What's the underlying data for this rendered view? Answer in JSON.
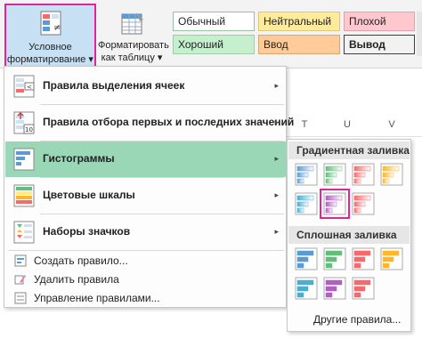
{
  "ribbon": {
    "conditional_formatting": {
      "line1": "Условное",
      "line2": "форматирование ▾"
    },
    "format_as_table": {
      "line1": "Форматировать",
      "line2": "как таблицу ▾"
    },
    "cell_styles": [
      {
        "label": "Обычный",
        "bg": "#ffffff",
        "border": "#9bbfa1"
      },
      {
        "label": "Нейтральный",
        "bg": "#ffeb9c",
        "border": "#d9c77d"
      },
      {
        "label": "Плохой",
        "bg": "#ffc7ce",
        "border": "#e0a3ab"
      },
      {
        "label": "Хороший",
        "bg": "#c6efce",
        "border": "#9ccfa8"
      },
      {
        "label": "Ввод",
        "bg": "#ffcc99",
        "border": "#d8a874"
      },
      {
        "label": "Вывод",
        "bg": "#f2f2f2",
        "border": "#3f3f3f"
      }
    ]
  },
  "sheet": {
    "columns": [
      "T",
      "U",
      "V"
    ]
  },
  "menu": {
    "items": [
      {
        "label": "Правила выделения ячеек",
        "icon": "highlight-rules-icon"
      },
      {
        "label": "Правила отбора первых и последних значений",
        "icon": "top-bottom-rules-icon"
      },
      {
        "label": "Гистограммы",
        "icon": "data-bars-icon"
      },
      {
        "label": "Цветовые шкалы",
        "icon": "color-scales-icon"
      },
      {
        "label": "Наборы значков",
        "icon": "icon-sets-icon"
      }
    ],
    "small_items": [
      {
        "label": "Создать правило...",
        "icon": "new-rule-icon"
      },
      {
        "label": "Удалить правила",
        "icon": "clear-rules-icon"
      },
      {
        "label": "Управление правилами...",
        "icon": "manage-rules-icon"
      }
    ],
    "icon_text_10": "10",
    "arrow": "▸"
  },
  "submenu": {
    "gradient_heading": "Градиентная заливка",
    "solid_heading": "Сплошная заливка",
    "more_rules": "Другие правила...",
    "colors": [
      "#5b9bd5",
      "#63be7b",
      "#f8696b",
      "#ffb628",
      "#4aaed0",
      "#b15fc4"
    ]
  },
  "colors": {
    "accent_highlight": "#e0249a",
    "menu_active": "#9ad7b7"
  }
}
